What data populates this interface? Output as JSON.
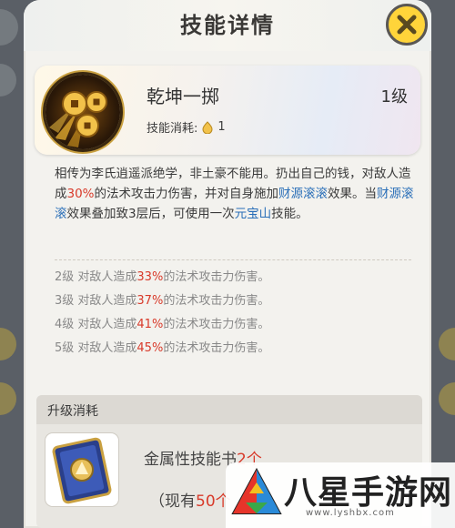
{
  "header": {
    "title": "技能详情"
  },
  "skill": {
    "name": "乾坤一掷",
    "level": "1级",
    "cost_label": "技能消耗:",
    "cost_value": "1",
    "icon": "coins-skill-icon"
  },
  "description": {
    "t1": "相传为李氏逍遥派绝学，非土豪不能用。扔出自己的钱，对敌人造成",
    "pct": "30%",
    "t2": "的法术攻击力伤害，并对自身施加",
    "effect1": "财源滚滚",
    "t3": "效果。当",
    "effect2": "财源滚滚",
    "t4": "效果叠加致3层后，可使用一次",
    "effect3": "元宝山",
    "t5": "技能。"
  },
  "levels": [
    {
      "prefix": "2级 对敌人造成",
      "pct": "33%",
      "suffix": "的法术攻击力伤害。"
    },
    {
      "prefix": "3级 对敌人造成",
      "pct": "37%",
      "suffix": "的法术攻击力伤害。"
    },
    {
      "prefix": "4级 对敌人造成",
      "pct": "41%",
      "suffix": "的法术攻击力伤害。"
    },
    {
      "prefix": "5级 对敌人造成",
      "pct": "45%",
      "suffix": "的法术攻击力伤害。"
    }
  ],
  "upgrade": {
    "title": "升级消耗",
    "item_name": "金属性技能书",
    "item_count": "2个",
    "owned_prefix": "（现有",
    "owned_count": "50个"
  },
  "watermark": {
    "brand": "八星手游网",
    "url": "www.lyshbx.com"
  },
  "colors": {
    "accent_red": "#d83a2a",
    "accent_blue": "#2a6fb8",
    "close_yellow": "#ffd43a"
  }
}
